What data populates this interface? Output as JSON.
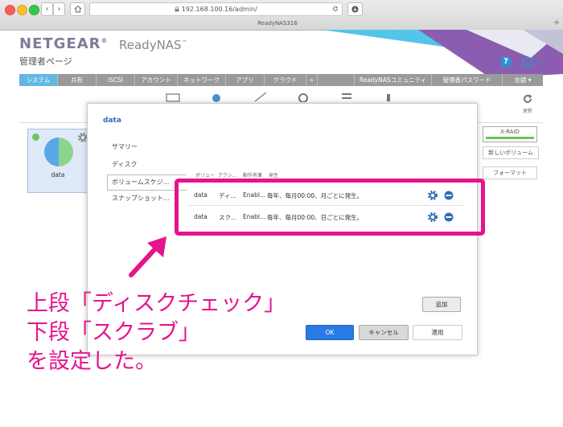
{
  "browser": {
    "url": "192.168.100.16/admin/",
    "tab_title": "ReadyNAS316",
    "back_glyph": "‹",
    "forward_glyph": "›",
    "new_tab_glyph": "+"
  },
  "header": {
    "logo": "NETGEAR",
    "trademark": "®",
    "product": "ReadyNAS",
    "product_tm": "™",
    "subtitle": "管理者ページ"
  },
  "menu": {
    "items": [
      "システム",
      "共有",
      "iSCSI",
      "アカウント",
      "ネットワーク",
      "アプリ",
      "クラウド",
      "»"
    ],
    "right_items": [
      "ReadyNASコミュニティ",
      "管理者パスワード",
      "言語 ▾"
    ]
  },
  "background": {
    "volume_name": "data",
    "xraid_label": "X-RAID",
    "new_volume_label": "新しいボリューム",
    "format_label": "フォーマット",
    "refresh_label": "更新"
  },
  "dialog": {
    "title": "data",
    "sidebar": [
      "サマリー",
      "ディスク",
      "ボリュームスケジ...",
      "スナップショット..."
    ],
    "columns": [
      "ボリュー",
      "アクシ...",
      "動作有兼",
      "発生"
    ],
    "rows": [
      {
        "volume": "data",
        "action": "ディ...",
        "enabled": "Enabl...",
        "schedule": "毎年、毎月00:00、月ごとに発生。"
      },
      {
        "volume": "data",
        "action": "スク...",
        "enabled": "Enabl...",
        "schedule": "毎年、毎月00:00、日ごとに発生。"
      }
    ],
    "add_label": "追加",
    "ok_label": "OK",
    "cancel_label": "キャンセル",
    "apply_label": "適用"
  },
  "annotation": {
    "line1": "上段「ディスクチェック」",
    "line2": "下段「スクラブ」",
    "line3": "を設定した。"
  },
  "colors": {
    "accent_magenta": "#e5148d",
    "menu_active": "#61b9e3",
    "ok_blue": "#2b7be6",
    "pie_green": "#8bd68c",
    "pie_blue": "#5aa7e8"
  }
}
